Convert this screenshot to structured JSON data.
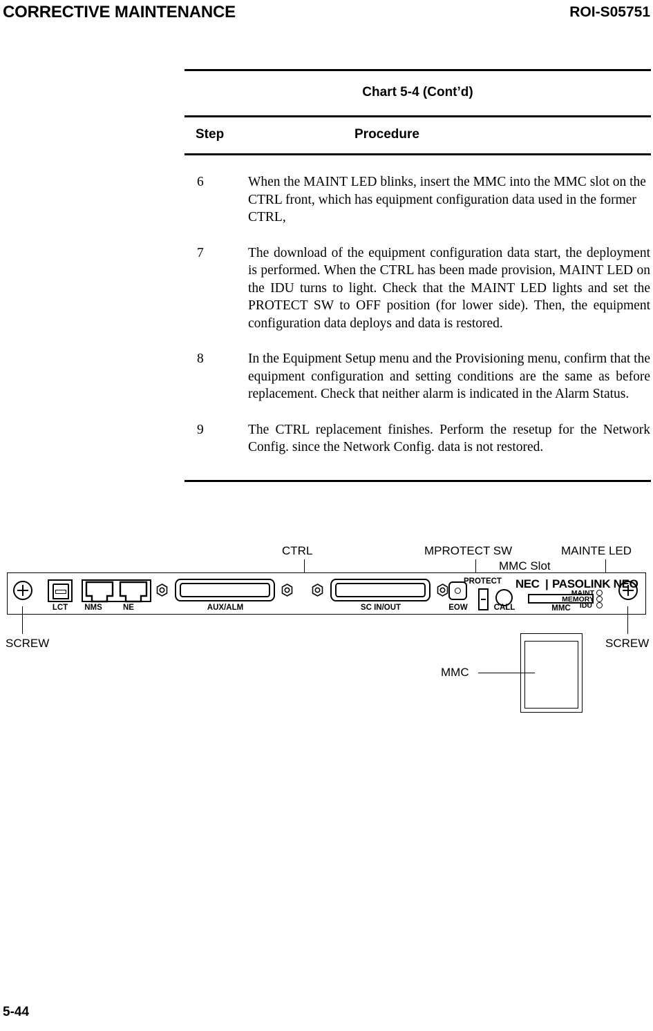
{
  "header": {
    "left_title": "CORRECTIVE MAINTENANCE",
    "doc_id": "ROI-S05751"
  },
  "chart": {
    "title": "Chart 5-4  (Cont’d)",
    "columns": {
      "step": "Step",
      "procedure": "Procedure"
    },
    "rows": [
      {
        "step": "6",
        "text": "When the MAINT LED blinks, insert the MMC into the MMC slot on the CTRL front, which has equipment configuration data used in the former CTRL,"
      },
      {
        "step": "7",
        "text": "The download of the equipment configuration data start, the deployment is performed.  When the CTRL has been made provision, MAINT LED on the IDU turns to light. Check that the MAINT LED lights and set the PROTECT SW to OFF position (for lower side).   Then, the equipment configuration data deploys and data is restored."
      },
      {
        "step": "8",
        "text": "In the Equipment Setup menu and the Provisioning menu, confirm that the equipment configuration and setting conditions are the same as before replacement.  Check that neither alarm is indicated in the Alarm Status."
      },
      {
        "step": "9",
        "text": "The CTRL replacement finishes.  Perform the resetup for the Network Config. since the Network Config. data is not restored."
      }
    ]
  },
  "figure": {
    "callouts": {
      "ctrl": "CTRL",
      "protect_sw": "MPROTECT SW",
      "mmc_slot": "MMC Slot",
      "mainte_led": "MAINTE LED",
      "screw_left": "SCREW",
      "screw_right": "SCREW",
      "mmc_card": "MMC"
    },
    "panel": {
      "ports": {
        "lct": "LCT",
        "nms": "NMS",
        "ne": "NE",
        "aux_alm": "AUX/ALM",
        "sc_in_out": "SC IN/OUT",
        "eow": "EOW",
        "protect": "PROTECT",
        "call": "CALL",
        "mmc": "MMC"
      },
      "brand": {
        "nec": "NEC",
        "divider": "|",
        "product": "PASOLINK NEO"
      },
      "leds": [
        {
          "label": "MAINT"
        },
        {
          "label": "MEMORY"
        },
        {
          "label": "IDU"
        }
      ]
    }
  },
  "footer": {
    "page": "5-44"
  }
}
